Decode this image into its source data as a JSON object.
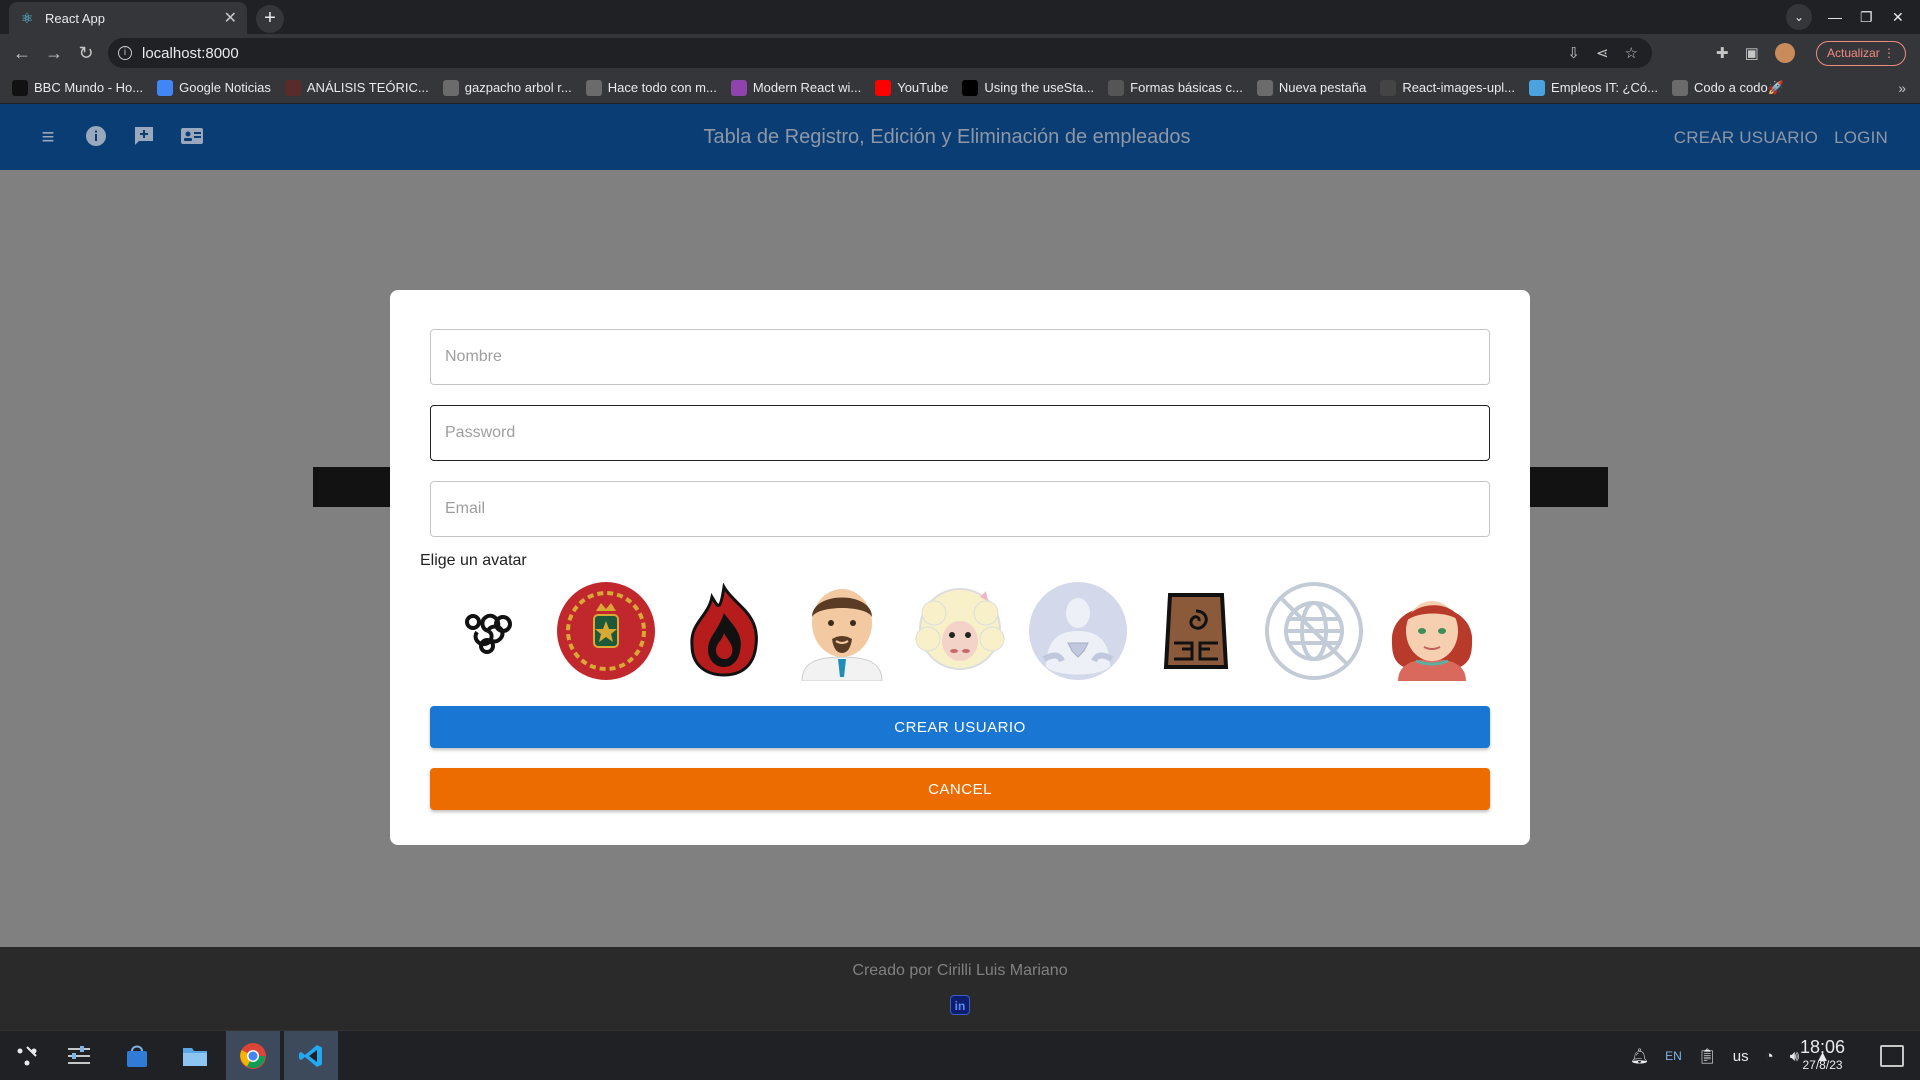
{
  "browser": {
    "tab_title": "React App",
    "url": "localhost:8000",
    "update_label": "Actualizar",
    "bookmarks": [
      {
        "label": "BBC Mundo - Ho...",
        "color": "#111111"
      },
      {
        "label": "Google Noticias",
        "color": "#4285f4"
      },
      {
        "label": "ANÁLISIS TEÓRIC...",
        "color": "#5a2b2b"
      },
      {
        "label": "gazpacho arbol r...",
        "color": "#6b6b6b"
      },
      {
        "label": "Hace todo con m...",
        "color": "#6b6b6b"
      },
      {
        "label": "Modern React wi...",
        "color": "#8e44ad"
      },
      {
        "label": "YouTube",
        "color": "#ff0000"
      },
      {
        "label": "Using the useSta...",
        "color": "#000000"
      },
      {
        "label": "Formas básicas c...",
        "color": "#555555"
      },
      {
        "label": "Nueva pestaña",
        "color": "#6b6b6b"
      },
      {
        "label": "React-images-upl...",
        "color": "#444444"
      },
      {
        "label": "Empleos IT: ¿Có...",
        "color": "#4aa3df"
      },
      {
        "label": "Codo a codo🚀",
        "color": "#6b6b6b"
      }
    ]
  },
  "app": {
    "title": "Tabla de Registro, Edición y Eliminación de empleados",
    "nav_create": "CREAR USUARIO",
    "nav_login": "LOGIN",
    "footer_credit": "Creado por Cirilli Luis Mariano",
    "linkedin": "in"
  },
  "modal": {
    "name_placeholder": "Nombre",
    "password_placeholder": "Password",
    "email_placeholder": "Email",
    "avatar_label": "Elige un avatar",
    "create_label": "CREAR USUARIO",
    "cancel_label": "CANCEL",
    "avatars": [
      "air-nation-avatar",
      "royal-emblem-avatar",
      "fire-nation-avatar",
      "bearded-man-avatar",
      "sheep-avatar",
      "superman-avatar",
      "earth-kingdom-avatar",
      "globe-avatar",
      "red-hair-woman-avatar"
    ]
  },
  "taskbar": {
    "lang": "EN",
    "layout": "us",
    "time": "18:06",
    "date": "27/8/23"
  },
  "colors": {
    "appbar": "#0b3d75",
    "primary": "#1976d2",
    "warning": "#ed6c02",
    "overlay": "#808080"
  }
}
